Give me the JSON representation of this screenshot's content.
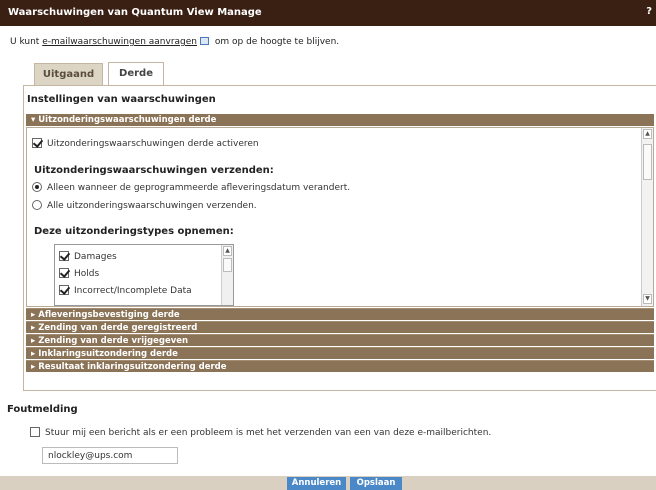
{
  "window": {
    "title": "Waarschuwingen van Quantum View Manage",
    "help_label": "?"
  },
  "intro": {
    "prefix": "U kunt ",
    "link": "e-mailwaarschuwingen aanvragen",
    "suffix": " om op de hoogte te blijven."
  },
  "tabs": [
    {
      "label": "Uitgaand"
    },
    {
      "label": "Derde"
    }
  ],
  "settings": {
    "title": "Instellingen van waarschuwingen",
    "open_section": {
      "label": "Uitzonderingswaarschuwingen derde",
      "activate_label": "Uitzonderingswaarschuwingen derde activeren",
      "activate_checked": true,
      "send_heading": "Uitzonderingswaarschuwingen verzenden:",
      "radio_options": [
        {
          "label": "Alleen wanneer de geprogrammeerde afleveringsdatum verandert.",
          "selected": true
        },
        {
          "label": "Alle uitzonderingswaarschuwingen verzenden.",
          "selected": false
        }
      ],
      "types_heading": "Deze uitzonderingstypes opnemen:",
      "exception_types": [
        {
          "label": "Damages",
          "checked": true
        },
        {
          "label": "Holds",
          "checked": true
        },
        {
          "label": "Incorrect/Incomplete Data",
          "checked": true
        }
      ]
    },
    "closed_sections": [
      {
        "label": "Afleveringsbevestiging derde"
      },
      {
        "label": "Zending van derde geregistreerd"
      },
      {
        "label": "Zending van derde vrijgegeven"
      },
      {
        "label": "Inklaringsuitzondering derde"
      },
      {
        "label": "Resultaat inklaringsuitzondering derde"
      }
    ]
  },
  "error": {
    "title": "Foutmelding",
    "checkbox_label": "Stuur mij een bericht als er een probleem is met het verzenden van een van deze e-mailberichten.",
    "checked": false,
    "email_value": "nlockley@ups.com"
  },
  "buttons": {
    "cancel": "Annuleren",
    "save": "Opslaan"
  },
  "icons": {
    "expanded": "triangle-down-icon",
    "collapsed": "triangle-right-icon",
    "email": "email-icon"
  },
  "colors": {
    "titlebar": "#3a1f13",
    "accordion_header": "#8b7357",
    "button": "#4a88c8",
    "footer": "#d9d0c1"
  }
}
